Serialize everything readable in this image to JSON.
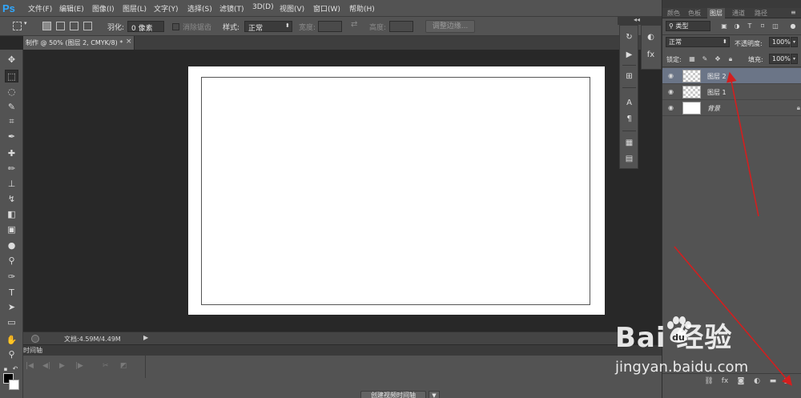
{
  "app": {
    "logo": "Ps"
  },
  "menu": {
    "items": [
      "文件(F)",
      "编辑(E)",
      "图像(I)",
      "图层(L)",
      "文字(Y)",
      "选择(S)",
      "滤镜(T)",
      "3D(D)",
      "视图(V)",
      "窗口(W)",
      "帮助(H)"
    ]
  },
  "window_controls": {
    "minimize": "—",
    "restore": "❐",
    "close": "✕"
  },
  "options": {
    "feather_label": "羽化:",
    "feather_value": "0 像素",
    "antialias_label": "消除锯齿",
    "style_label": "样式:",
    "style_value": "正常",
    "width_label": "宽度:",
    "height_label": "高度:",
    "refine_edge": "调整边缘..."
  },
  "document": {
    "tab_title": "制作 @ 50% (图层 2, CMYK/8) *",
    "close": "×"
  },
  "status": {
    "doc_size": "文档:4.59M/4.49M",
    "arrow": "▶"
  },
  "timeline": {
    "title": "时间轴",
    "create_button": "创建视频时间轴",
    "dropdown": "▼"
  },
  "panels": {
    "collapse": "◂◂",
    "tabs": [
      "颜色",
      "色板",
      "图层",
      "通道",
      "路径"
    ],
    "active_tab": "图层",
    "menu_icon": "≡"
  },
  "layers": {
    "filter_kind": "类型",
    "blend_mode": "正常",
    "opacity_label": "不透明度:",
    "opacity_value": "100%",
    "lock_label": "锁定:",
    "fill_label": "填充:",
    "fill_value": "100%",
    "items": [
      {
        "name": "图层 2",
        "selected": true,
        "thumb": "transparent"
      },
      {
        "name": "图层 1",
        "selected": false,
        "thumb": "transparent"
      },
      {
        "name": "背景",
        "selected": false,
        "thumb": "white",
        "locked": true
      }
    ]
  },
  "colors": {
    "foreground": "#000000",
    "background": "#ffffff",
    "annotation_arrow": "#d21f1f"
  },
  "watermark": {
    "brand": "Bai  经验",
    "url": "jingyan.baidu.com"
  }
}
